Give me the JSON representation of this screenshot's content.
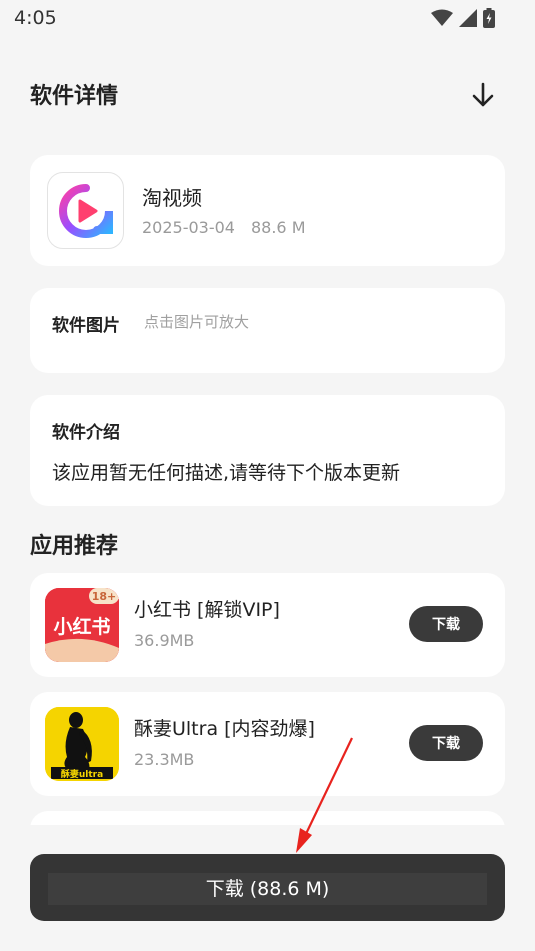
{
  "status_bar": {
    "time": "4:05",
    "icons": [
      "wifi-icon",
      "signal-icon",
      "battery-icon"
    ]
  },
  "header": {
    "title": "软件详情",
    "download_icon": "download-arrow-icon"
  },
  "app": {
    "name": "淘视频",
    "date": "2025-03-04",
    "size": "88.6 M",
    "icon": "tao-video-logo"
  },
  "screenshots": {
    "label": "软件图片",
    "hint": "点击图片可放大"
  },
  "intro": {
    "label": "软件介绍",
    "text": "该应用暂无任何描述,请等待下个版本更新"
  },
  "recommendations": {
    "title": "应用推荐",
    "items": [
      {
        "name": "小红书 [解锁VIP]",
        "size": "36.9MB",
        "button": "下载",
        "icon_text": "小红书",
        "badge": "18+"
      },
      {
        "name": "酥妻Ultra [内容劲爆]",
        "size": "23.3MB",
        "button": "下载",
        "icon_text": "酥妻ultra"
      }
    ]
  },
  "bottom": {
    "label": "下载 (88.6 M)"
  },
  "colors": {
    "accent_dark": "#353535",
    "annotation_red": "#e8231e",
    "xhs_red": "#e8323c",
    "yellow": "#f5d400"
  }
}
